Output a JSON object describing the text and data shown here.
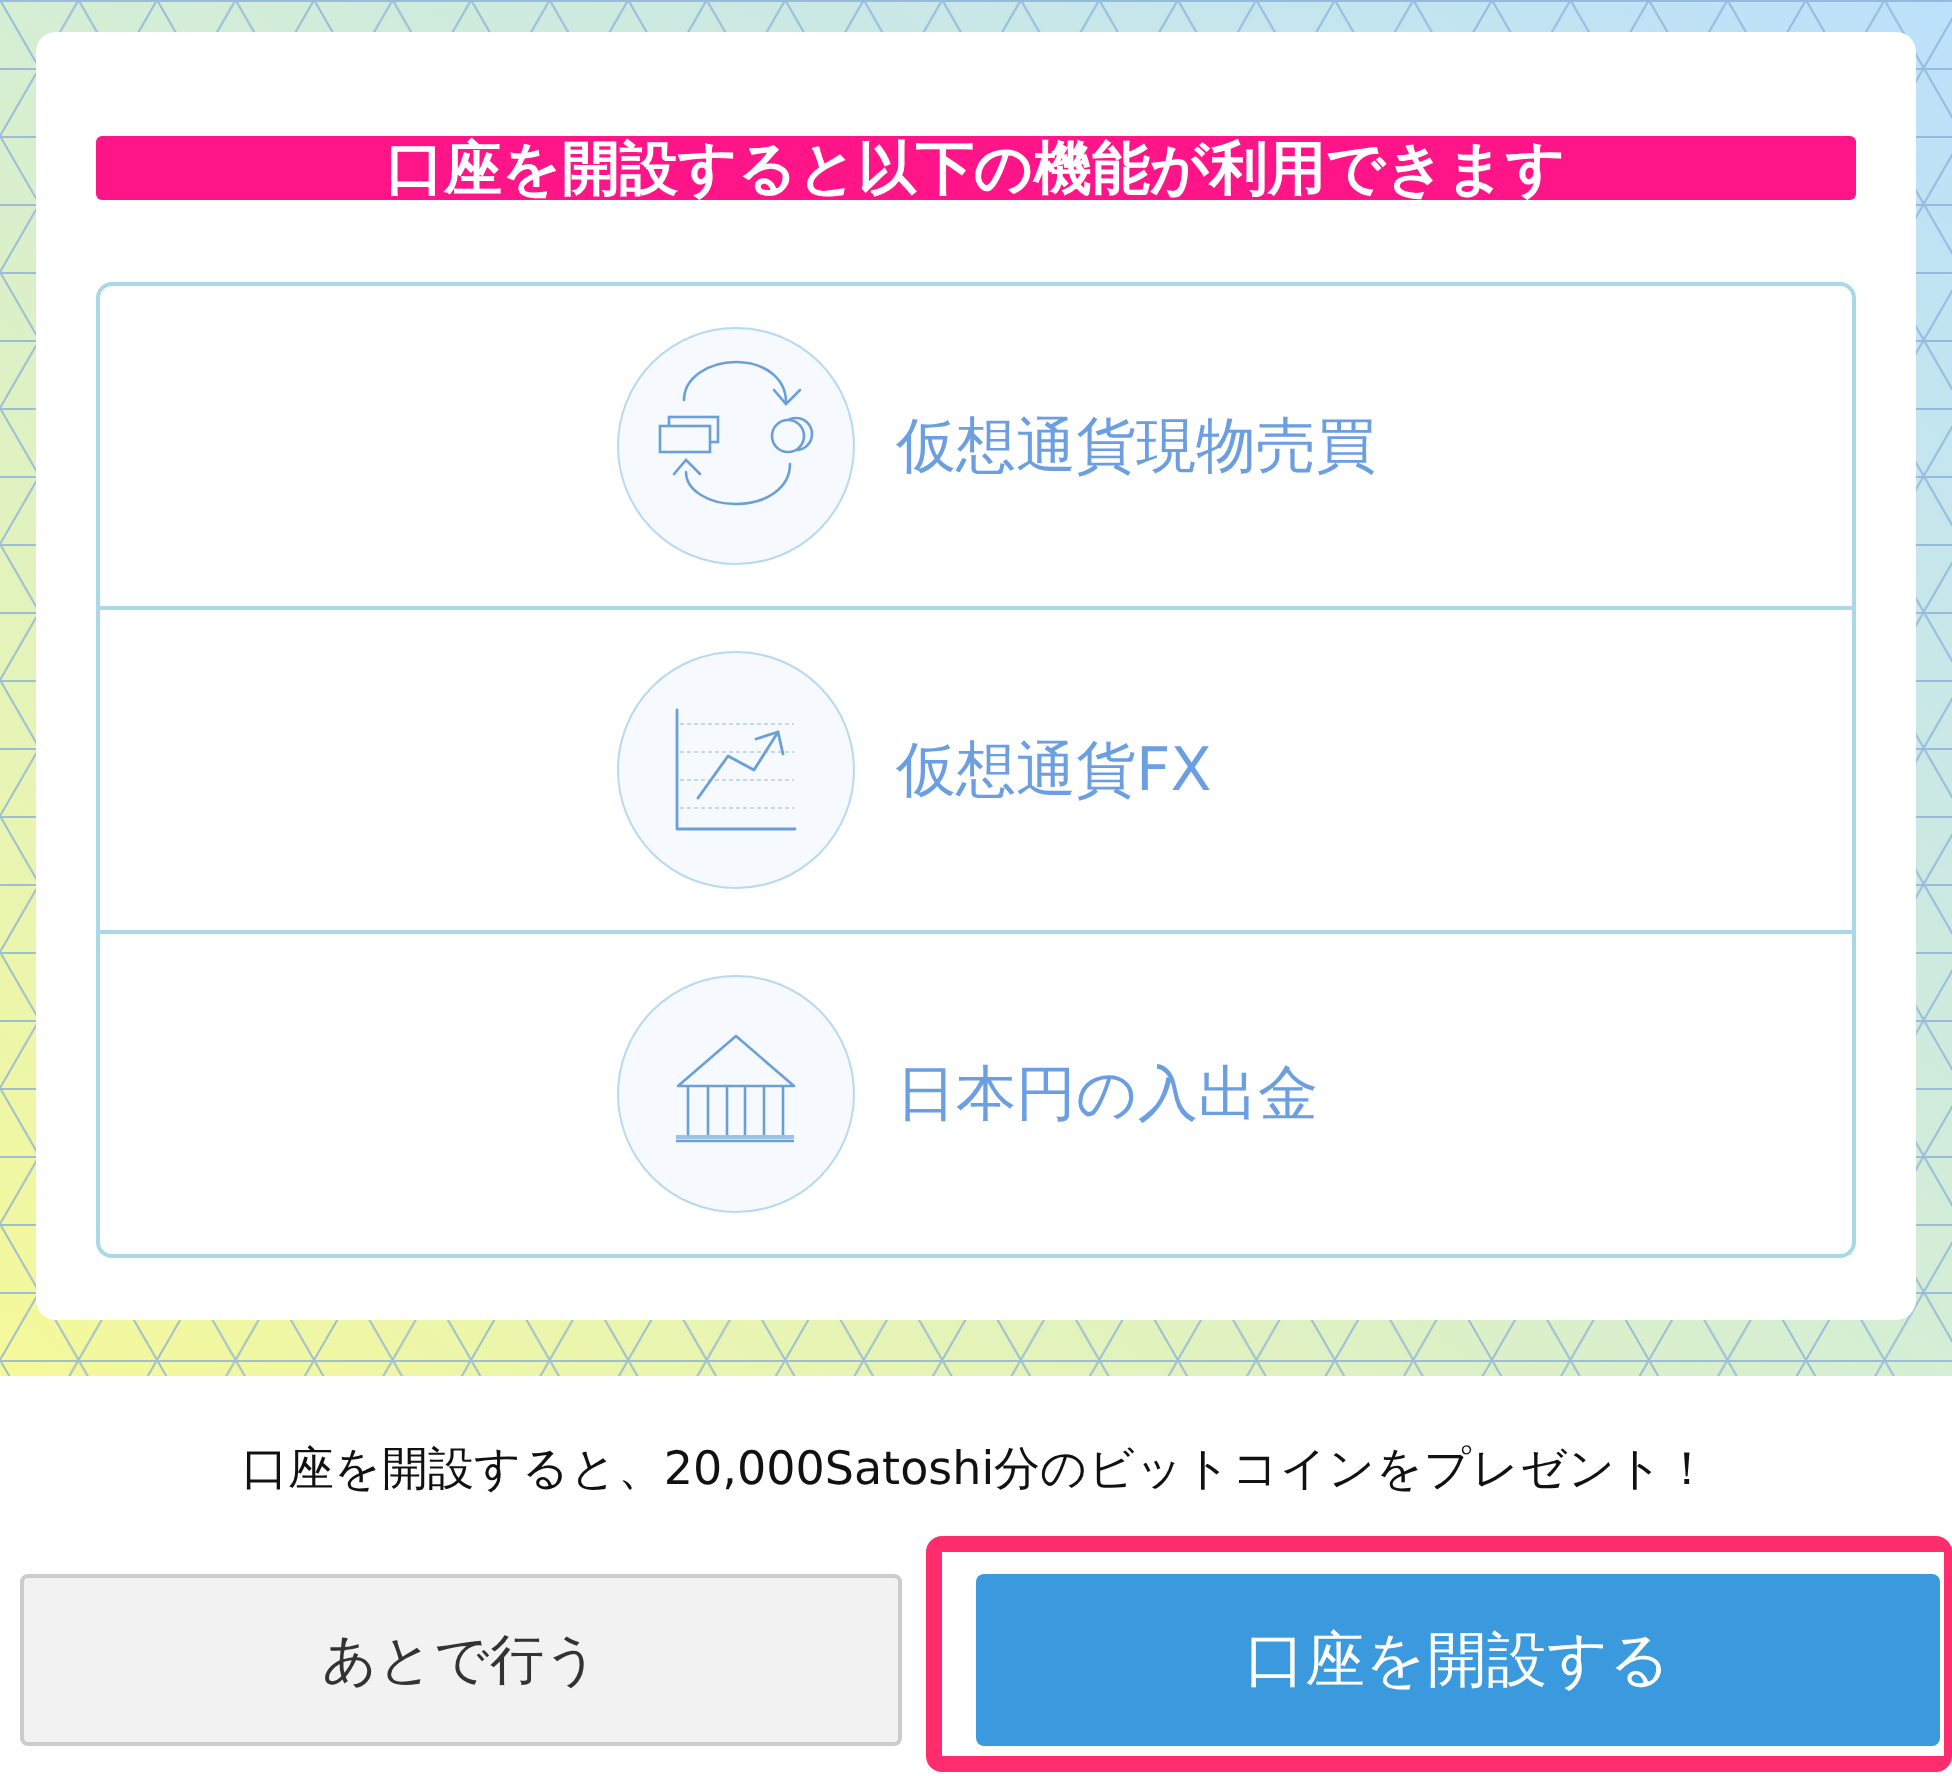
{
  "banner": {
    "title": "口座を開設すると以下の機能が利用できます"
  },
  "features": [
    {
      "kind": "exchange",
      "label": "仮想通貨現物売買"
    },
    {
      "kind": "chart",
      "label": "仮想通貨FX"
    },
    {
      "kind": "bank",
      "label": "日本円の入出金"
    }
  ],
  "bonus_note": "口座を開設すると、20,000Satoshi分のビットコインをプレゼント！",
  "buttons": [
    {
      "kind": "secondary",
      "label": "あとで行う",
      "highlighted": false
    },
    {
      "kind": "primary",
      "label": "口座を開設する",
      "highlighted": true
    }
  ]
}
